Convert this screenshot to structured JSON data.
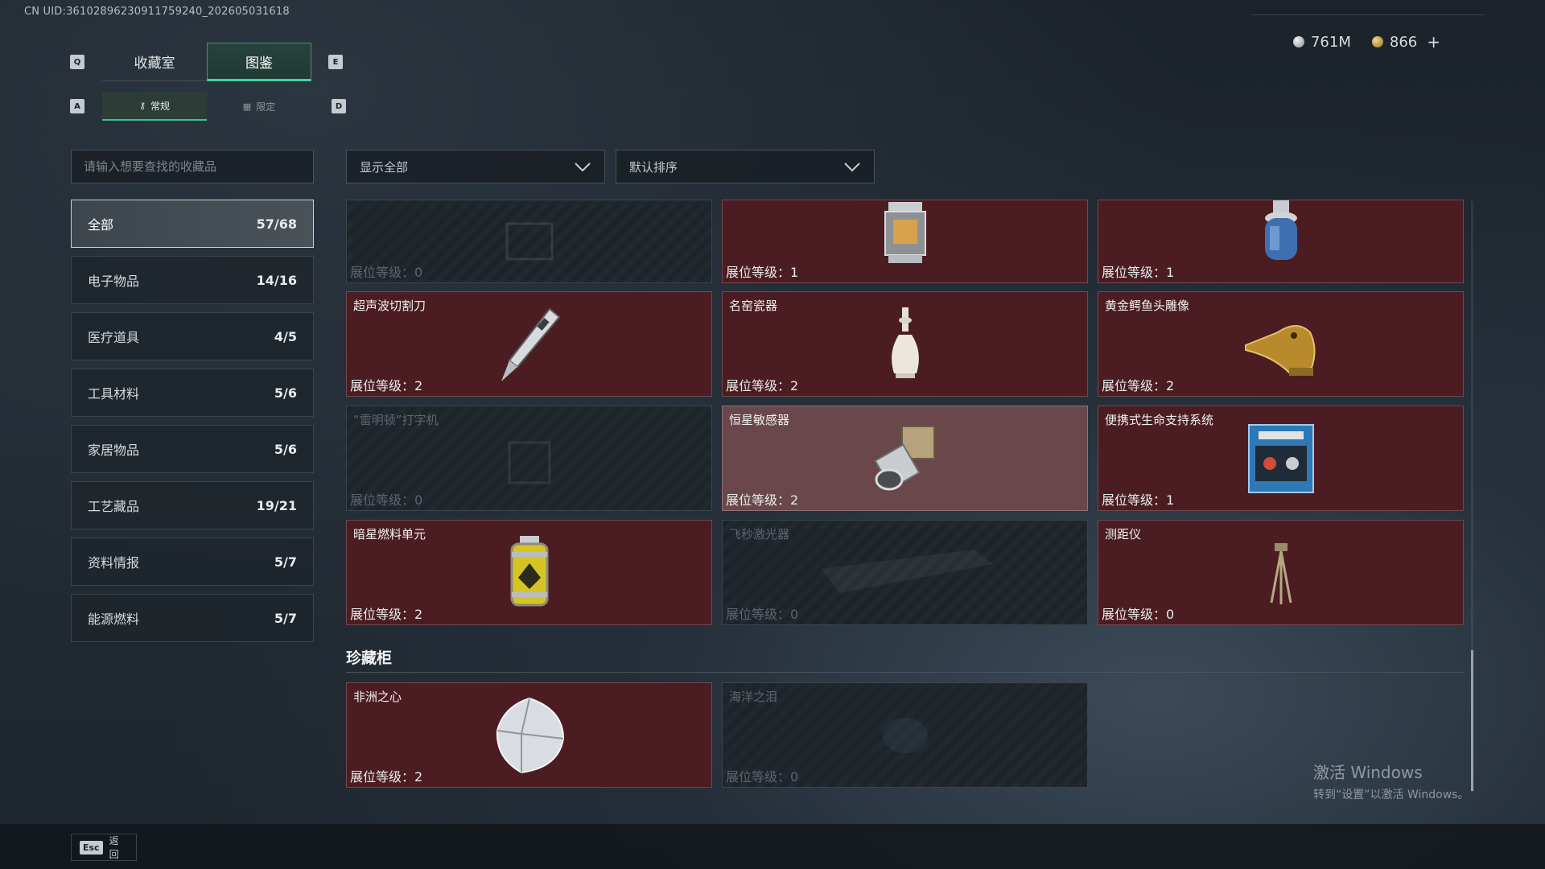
{
  "uid": "CN UID:3610289623091175924​0_202605031618",
  "currency": {
    "silver": "761M",
    "gold": "866",
    "plus": "+"
  },
  "keys": {
    "prev_tab": "Q",
    "next_tab": "E",
    "prev_sub": "A",
    "next_sub": "D"
  },
  "tabs": [
    {
      "label": "收藏室",
      "active": false
    },
    {
      "label": "图鉴",
      "active": true
    }
  ],
  "sub_tabs": [
    {
      "label": "常规",
      "active": true
    },
    {
      "label": "限定",
      "active": false
    }
  ],
  "search": {
    "placeholder": "请输入想要查找的收藏品"
  },
  "filters": {
    "show": "显示全部",
    "sort": "默认排序"
  },
  "categories": [
    {
      "label": "全部",
      "count": "57/68"
    },
    {
      "label": "电子物品",
      "count": "14/16"
    },
    {
      "label": "医疗道具",
      "count": "4/5"
    },
    {
      "label": "工具材料",
      "count": "5/6"
    },
    {
      "label": "家居物品",
      "count": "5/6"
    },
    {
      "label": "工艺藏品",
      "count": "19/21"
    },
    {
      "label": "资料情报",
      "count": "5/7"
    },
    {
      "label": "能源燃料",
      "count": "5/7"
    }
  ],
  "level_prefix": "展位等级：",
  "cards": [
    {
      "name": "",
      "level": "0",
      "state": "locked",
      "icon": "box-item-icon"
    },
    {
      "name": "",
      "level": "1",
      "state": "owned",
      "icon": "lantern-icon"
    },
    {
      "name": "",
      "level": "1",
      "state": "owned",
      "icon": "gas-canister-icon"
    },
    {
      "name": "超声波切割刀",
      "level": "2",
      "state": "owned",
      "icon": "cutter-knife-icon"
    },
    {
      "name": "名窑瓷器",
      "level": "2",
      "state": "owned",
      "icon": "porcelain-vase-icon"
    },
    {
      "name": "黄金鳄鱼头雕像",
      "level": "2",
      "state": "owned",
      "icon": "gold-crocodile-icon"
    },
    {
      "name": "“雷明顿”打字机",
      "level": "0",
      "state": "locked",
      "icon": "typewriter-icon"
    },
    {
      "name": "恒星敏感器",
      "level": "2",
      "state": "lit",
      "icon": "star-sensor-icon"
    },
    {
      "name": "便携式生命支持系统",
      "level": "1",
      "state": "owned",
      "icon": "life-support-icon"
    },
    {
      "name": "暗星燃料单元",
      "level": "2",
      "state": "owned",
      "icon": "fuel-cell-icon"
    },
    {
      "name": "飞秒激光器",
      "level": "0",
      "state": "locked",
      "icon": "laser-device-icon"
    },
    {
      "name": "测距仪",
      "level": "0",
      "state": "owned",
      "icon": "rangefinder-tripod-icon"
    }
  ],
  "section": {
    "title": "珍藏柜"
  },
  "vault_cards": [
    {
      "name": "非洲之心",
      "level": "2",
      "state": "owned",
      "icon": "diamond-icon"
    },
    {
      "name": "海洋之泪",
      "level": "0",
      "state": "locked",
      "icon": "gem-icon"
    }
  ],
  "watermark": {
    "line1": "激活 Windows",
    "line2": "转到“设置”以激活 Windows。"
  },
  "back": {
    "key": "Esc",
    "label": "返回"
  }
}
